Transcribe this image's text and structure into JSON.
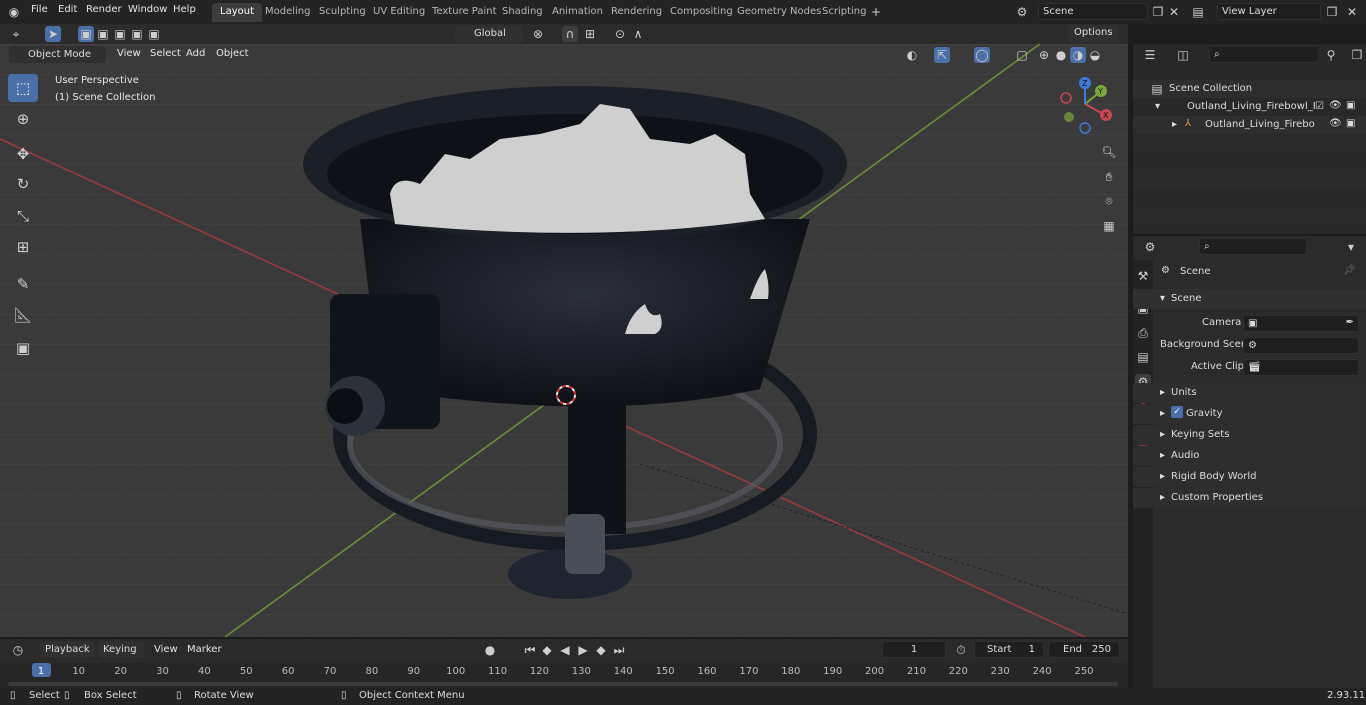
{
  "menu": {
    "file": "File",
    "edit": "Edit",
    "render": "Render",
    "window": "Window",
    "help": "Help"
  },
  "workspaces": [
    "Layout",
    "Modeling",
    "Sculpting",
    "UV Editing",
    "Texture Paint",
    "Shading",
    "Animation",
    "Rendering",
    "Compositing",
    "Geometry Nodes",
    "Scripting"
  ],
  "scene_name": "Scene",
  "view_layer": "View Layer",
  "header": {
    "options": "Options",
    "transform_orientation": "Global",
    "mode": "Object Mode",
    "view": "View",
    "select": "Select",
    "add": "Add",
    "object": "Object"
  },
  "viewport": {
    "perspective": "User Perspective",
    "collection": "(1) Scene Collection"
  },
  "gizmo": {
    "x": "X",
    "y": "Y",
    "z": "Z"
  },
  "outliner": {
    "root": "Scene Collection",
    "item1": "Outland_Living_Firebowl_Prop",
    "item2": "Outland_Living_Firebowl"
  },
  "properties": {
    "breadcrumb": "Scene",
    "section": "Scene",
    "camera_label": "Camera",
    "bg_label": "Background Scene",
    "clip_label": "Active Clip",
    "panels": [
      "Units",
      "Gravity",
      "Keying Sets",
      "Audio",
      "Rigid Body World",
      "Custom Properties"
    ]
  },
  "timeline": {
    "playback": "Playback",
    "keying": "Keying",
    "view": "View",
    "marker": "Marker",
    "current_frame": "1",
    "start_label": "Start",
    "start": "1",
    "end_label": "End",
    "end": "250",
    "ticks": [
      "1",
      "10",
      "20",
      "30",
      "40",
      "50",
      "60",
      "70",
      "80",
      "90",
      "100",
      "110",
      "120",
      "130",
      "140",
      "150",
      "160",
      "170",
      "180",
      "190",
      "200",
      "210",
      "220",
      "230",
      "240",
      "250"
    ]
  },
  "status": {
    "select": "Select",
    "box_select": "Box Select",
    "rotate": "Rotate View",
    "context": "Object Context Menu",
    "version": "2.93.11"
  },
  "colors": {
    "accent": "#4b6fa8",
    "x_axis": "#c8484f",
    "y_axis": "#7aa83a",
    "z_axis": "#3f7ad8"
  }
}
